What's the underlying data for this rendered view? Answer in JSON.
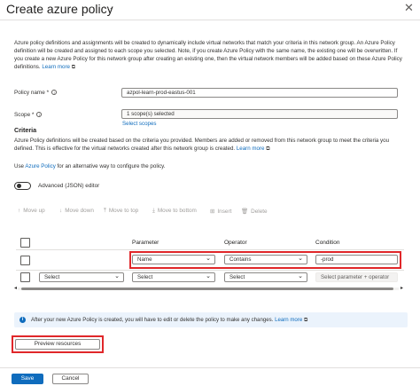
{
  "header": {
    "title": "Create azure policy",
    "more_label": "…",
    "close_label": "✕"
  },
  "intro": {
    "text": "Azure policy definitions and assignments will be created to dynamically include virtual networks that match your criteria in this network group. An Azure Policy definition will be created and assigned to each scope you selected. Note, if you create Azure Policy with the same name, the existing one will be overwritten. If you create a new Azure Policy for this network group after creating an existing one, then the virtual network members will be added based on these Azure Policy definitions.",
    "link": "Learn more"
  },
  "form": {
    "policy_name_label": "Policy name *",
    "policy_name_value": "azpol-learn-prod-eastus-001",
    "scope_label": "Scope *",
    "scope_value": "1 scope(s) selected",
    "select_scopes_link": "Select scopes"
  },
  "criteria": {
    "heading": "Criteria",
    "text": "Azure Policy definitions will be created based on the criteria you provided. Members are added or removed from this network group to meet the criteria you defined. This is effective for the virtual networks created after this network group is created.",
    "link": "Learn more",
    "alt_prefix": "Use",
    "alt_link": "Azure Policy",
    "alt_suffix": "for an alternative way to configure the policy.",
    "advanced_toggle_label": "Advanced (JSON) editor"
  },
  "toolbar": {
    "move_up": "Move up",
    "move_down": "Move down",
    "move_to_top": "Move to top",
    "move_to_bottom": "Move to bottom",
    "insert": "Insert",
    "delete": "Delete"
  },
  "table": {
    "headers": [
      "Parameter",
      "Operator",
      "Condition"
    ],
    "row1": {
      "parameter": "Name",
      "operator": "Contains",
      "condition": "-prod"
    },
    "row2": {
      "first": "Select",
      "parameter": "Select",
      "operator": "Select",
      "condition": "Select parameter + operator"
    }
  },
  "info_bar": {
    "text": "After your new Azure Policy is created, you will have to edit or delete the policy to make any changes.",
    "link": "Learn more"
  },
  "buttons": {
    "preview": "Preview resources",
    "save": "Save",
    "cancel": "Cancel"
  },
  "colors": {
    "accent": "#0f6cbd",
    "highlight": "#e0272a"
  }
}
